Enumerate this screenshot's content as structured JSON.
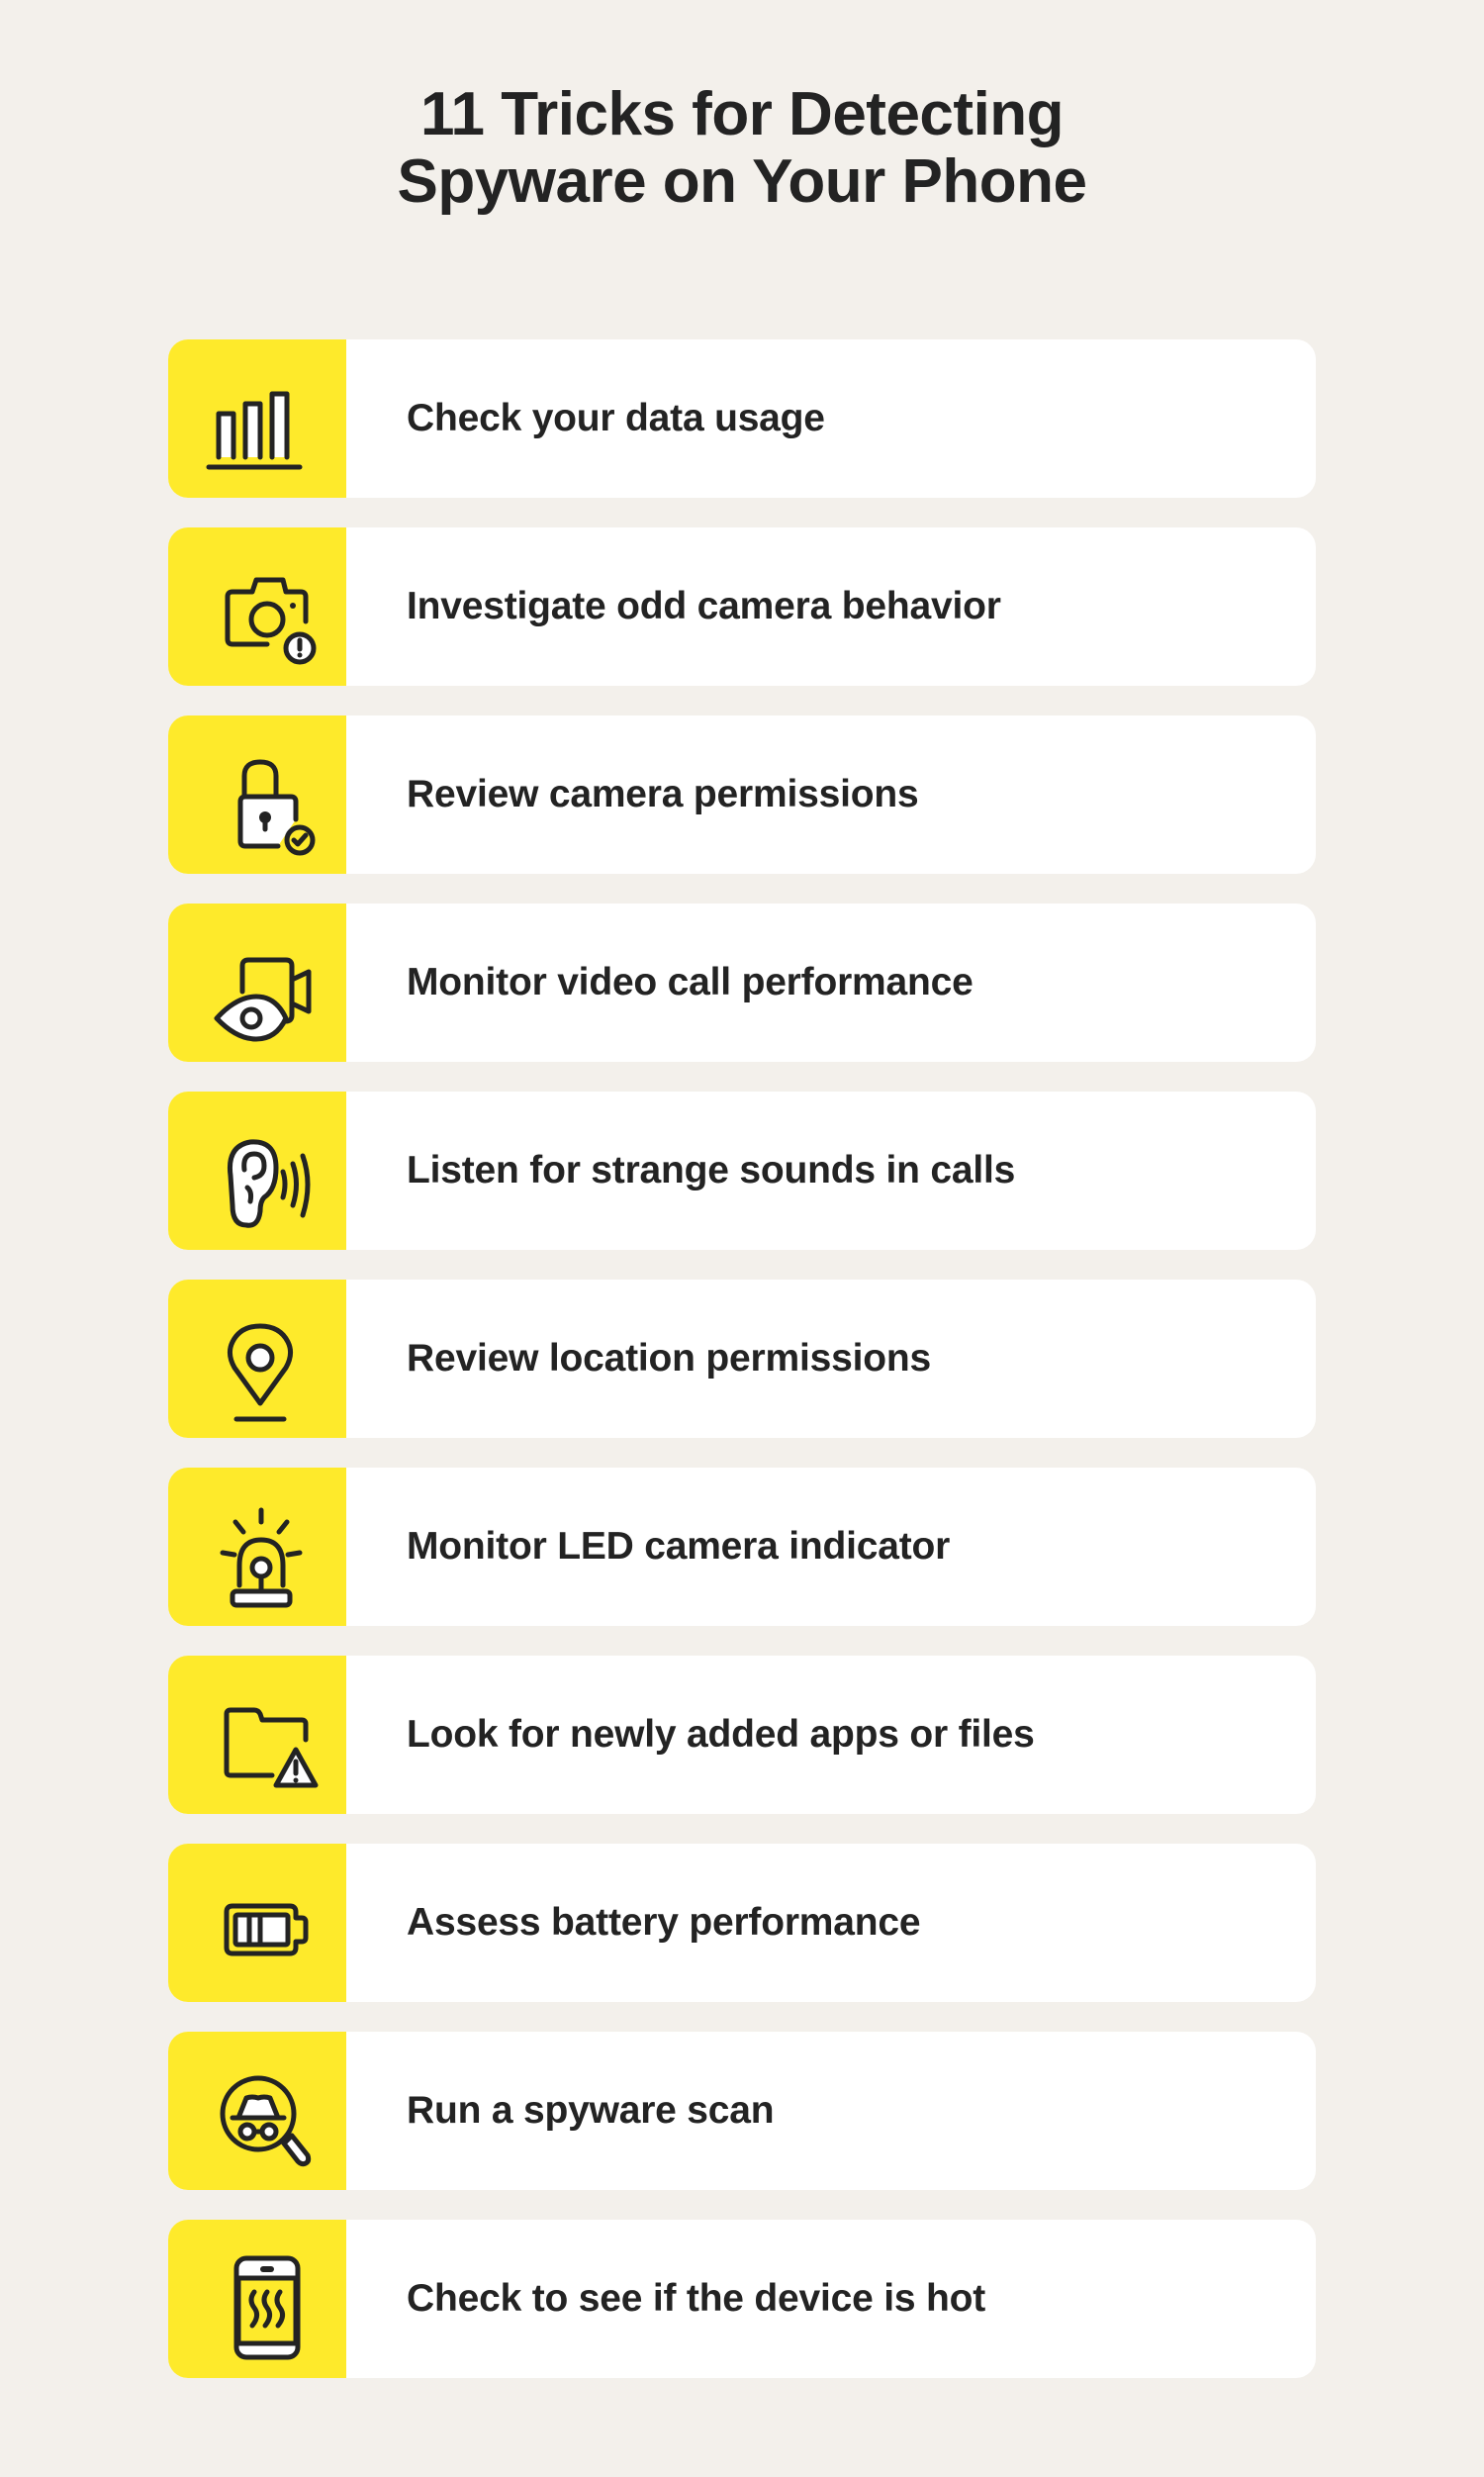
{
  "title": {
    "line1": "11 Tricks for Detecting",
    "line2": "Spyware on Your Phone"
  },
  "colors": {
    "background": "#F3F0EB",
    "accent_yellow": "#FEEA2B",
    "card": "#FFFFFF",
    "text": "#232323"
  },
  "tips": [
    {
      "icon": "bar-chart-icon",
      "label": "Check your data usage"
    },
    {
      "icon": "camera-alert-icon",
      "label": "Investigate odd camera behavior"
    },
    {
      "icon": "padlock-check-icon",
      "label": "Review camera permissions"
    },
    {
      "icon": "video-camera-eye-icon",
      "label": "Monitor video call performance"
    },
    {
      "icon": "ear-sound-icon",
      "label": "Listen for strange sounds in calls"
    },
    {
      "icon": "location-pin-icon",
      "label": "Review location permissions"
    },
    {
      "icon": "siren-light-icon",
      "label": "Monitor LED camera indicator"
    },
    {
      "icon": "folder-warning-icon",
      "label": "Look for newly added apps or files"
    },
    {
      "icon": "battery-icon",
      "label": "Assess battery performance"
    },
    {
      "icon": "spy-magnifier-icon",
      "label": "Run a spyware scan"
    },
    {
      "icon": "hot-phone-icon",
      "label": "Check to see if the device is hot"
    }
  ]
}
